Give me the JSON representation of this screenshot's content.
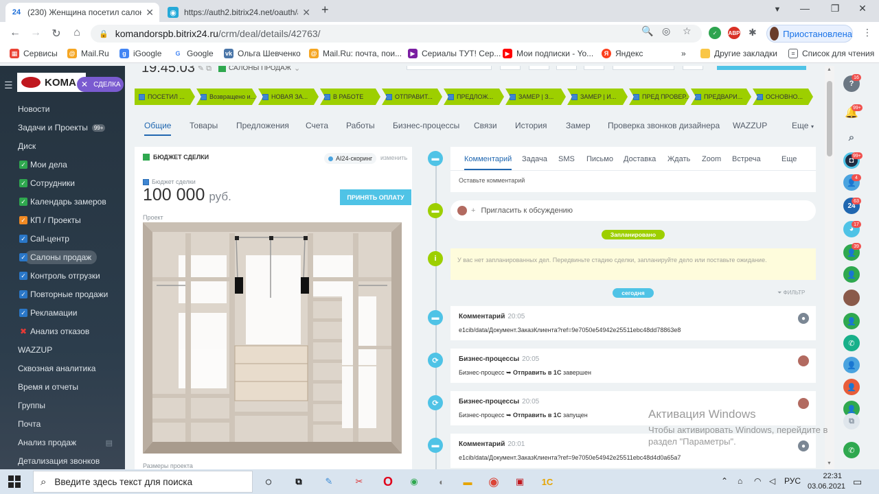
{
  "browser": {
    "tabs": [
      {
        "title": "(230) Женщина посетил салон С",
        "active": true
      },
      {
        "title": "https://auth2.bitrix24.net/oauth/a",
        "active": false
      }
    ],
    "url_host": "komandorspb.bitrix24.ru",
    "url_path": "/crm/deal/details/42763/",
    "profile_label": "Приостановлена",
    "bookmarks": [
      "Сервисы",
      "Mail.Ru",
      "iGoogle",
      "Google",
      "Ольга Шевченко",
      "Mail.Ru: почта, пои...",
      "Сериалы ТУТ! Сер...",
      "Мои подписки - Yo...",
      "Яндекс"
    ],
    "bookmarks_more": "»",
    "other_bookmarks": "Другие закладки",
    "reading_list": "Список для чтения",
    "extensions": {
      "abp": "ABP"
    }
  },
  "sidebar": {
    "logo": "KOMA",
    "deal_pill": "СДЕЛКА",
    "items": [
      {
        "label": "Новости",
        "type": "top"
      },
      {
        "label": "Задачи и Проекты",
        "type": "top",
        "counter": "99+"
      },
      {
        "label": "Диск",
        "type": "top"
      },
      {
        "label": "Мои дела",
        "type": "check"
      },
      {
        "label": "Сотрудники",
        "type": "check"
      },
      {
        "label": "Календарь замеров",
        "type": "check"
      },
      {
        "label": "КП / Проекты",
        "type": "orange"
      },
      {
        "label": "Call-центр",
        "type": "blue"
      },
      {
        "label": "Салоны продаж",
        "type": "blue",
        "active": true
      },
      {
        "label": "Контроль отгрузки",
        "type": "blue"
      },
      {
        "label": "Повторные продажи",
        "type": "blue"
      },
      {
        "label": "Рекламации",
        "type": "blue"
      },
      {
        "label": "Анализ отказов",
        "type": "red"
      },
      {
        "label": "WAZZUP",
        "type": "top"
      },
      {
        "label": "Сквозная аналитика",
        "type": "top"
      },
      {
        "label": "Время и отчеты",
        "type": "top"
      },
      {
        "label": "Группы",
        "type": "top"
      },
      {
        "label": "Почта",
        "type": "top"
      },
      {
        "label": "Анализ продаж",
        "type": "top"
      },
      {
        "label": "Детализация звонков",
        "type": "top"
      }
    ]
  },
  "deal": {
    "time": "19:45:03",
    "category": "САЛОНЫ ПРОДАЖ",
    "stages": [
      "ПОСЕТИЛ ...",
      "Возвращено и...",
      "НОВАЯ ЗА...",
      "В РАБОТЕ",
      "ОТПРАВИТ...",
      "ПРЕДЛОЖ...",
      "ЗАМЕР | З...",
      "ЗАМЕР | И...",
      "ПРЕД ПРОВЕР...",
      "ПРЕДВАРИ...",
      "ОСНОВНО..."
    ],
    "tabs": [
      "Общие",
      "Товары",
      "Предложения",
      "Счета",
      "Работы",
      "Бизнес-процессы",
      "Связи",
      "История",
      "Замер",
      "Проверка звонков дизайнера",
      "WAZZUP",
      "Еще"
    ],
    "budget": {
      "section_title": "БЮДЖЕТ СДЕЛКИ",
      "ai_scoring": "AI24-скоринг",
      "change": "изменить",
      "label": "Бюджет сделки",
      "amount": "100 000",
      "currency": "руб.",
      "pay_button": "ПРИНЯТЬ ОПЛАТУ",
      "project_label": "Проект",
      "size_label": "Размеры проекта"
    }
  },
  "timeline": {
    "editor_tabs": [
      "Комментарий",
      "Задача",
      "SMS",
      "Письмо",
      "Доставка",
      "Ждать",
      "Zoom",
      "Встреча",
      "Еще"
    ],
    "comment_placeholder": "Оставьте комментарий",
    "invite": "Пригласить к обсуждению",
    "planned_badge": "Запланировано",
    "planned_text": "У вас нет запланированных дел. Передвиньте стадию сделки, запланируйте дело или поставьте ожидание.",
    "today_badge": "сегодня",
    "filter": "ФИЛЬТР",
    "events": [
      {
        "title": "Комментарий",
        "time": "20:05",
        "text": "e1cib/data/Документ.ЗаказКлиента?ref=9e7050e54942e25511ebc48dd78863e8"
      },
      {
        "title": "Бизнес-процессы",
        "time": "20:05",
        "prefix": "Бизнес-процесс ➥",
        "bold": "Отправить в 1С",
        "suffix": "завершен"
      },
      {
        "title": "Бизнес-процессы",
        "time": "20:05",
        "prefix": "Бизнес-процесс ➥",
        "bold": "Отправить в 1С",
        "suffix": "запущен"
      },
      {
        "title": "Комментарий",
        "time": "20:01",
        "text": "e1cib/data/Документ.ЗаказКлиента?ref=9e7050e54942e25511ebc48d4d0a65a7"
      }
    ]
  },
  "right_panel": {
    "badges": [
      "16",
      "99+",
      "99+",
      "4",
      "63",
      "17",
      "39"
    ],
    "b24": "24"
  },
  "watermark": {
    "line1": "Активация Windows",
    "line2": "Чтобы активировать Windows, перейдите в",
    "line3": "раздел \"Параметры\"."
  },
  "taskbar": {
    "search_placeholder": "Введите здесь текст для поиска",
    "lang": "РУС",
    "time": "22:31",
    "date": "03.06.2021"
  }
}
